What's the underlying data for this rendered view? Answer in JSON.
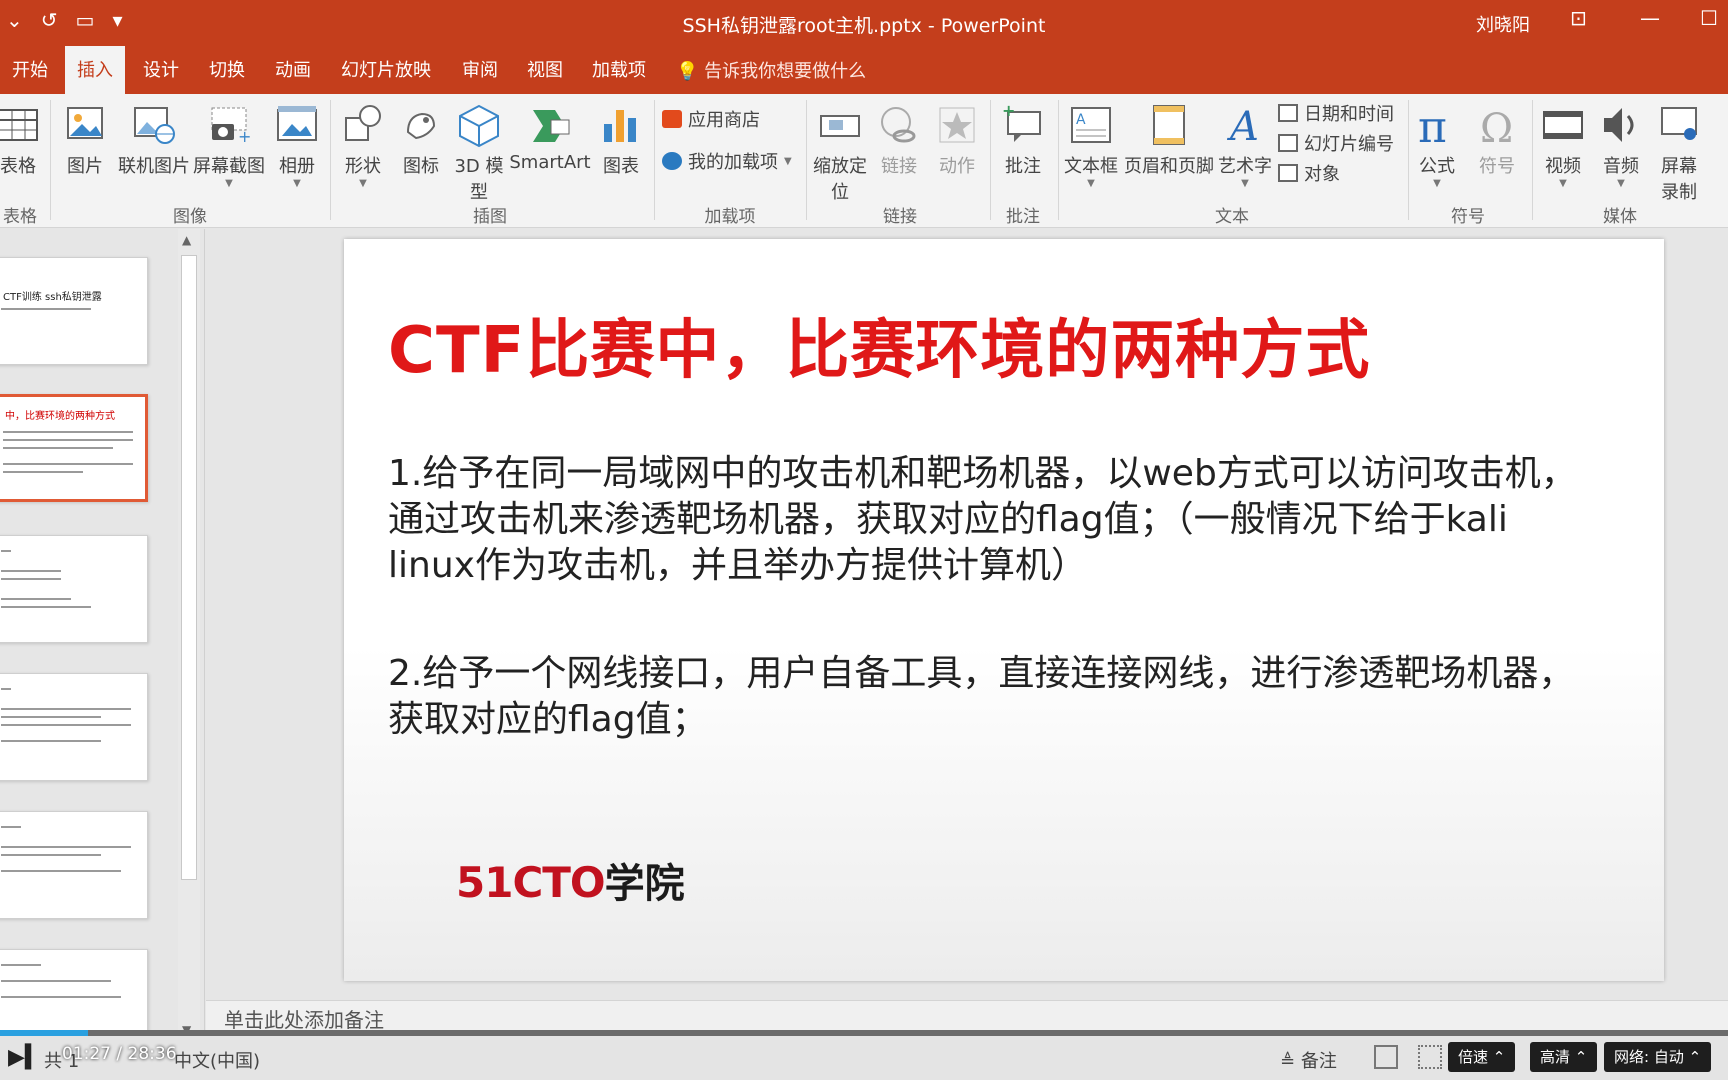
{
  "window": {
    "title": "SSH私钥泄露root主机.pptx  -  PowerPoint",
    "user": "刘晓阳"
  },
  "tabs": [
    "开始",
    "插入",
    "设计",
    "切换",
    "动画",
    "幻灯片放映",
    "审阅",
    "视图",
    "加载项"
  ],
  "active_tab": "插入",
  "tell_me": "告诉我你想要做什么",
  "share_label": "共",
  "ribbon": {
    "groups": {
      "tables": "表格",
      "images": "图像",
      "illustrations": "插图",
      "addins": "加载项",
      "links": "链接",
      "comments": "批注",
      "text": "文本",
      "symbols": "符号",
      "media": "媒体"
    },
    "buttons": {
      "table": "表格",
      "picture": "图片",
      "online_picture": "联机图片",
      "screenshot": "屏幕截图",
      "album": "相册",
      "shapes": "形状",
      "icons": "图标",
      "model3d_1": "3D 模",
      "model3d_2": "型",
      "smartart": "SmartArt",
      "chart": "图表",
      "store": "应用商店",
      "my_addins": "我的加载项",
      "zoom_1": "缩放定",
      "zoom_2": "位",
      "link": "链接",
      "action": "动作",
      "comment": "批注",
      "textbox": "文本框",
      "header_footer": "页眉和页脚",
      "wordart": "艺术字",
      "datetime": "日期和时间",
      "slide_number": "幻灯片编号",
      "object": "对象",
      "equation": "公式",
      "symbol": "符号",
      "video": "视频",
      "audio": "音频",
      "screen_rec_1": "屏幕",
      "screen_rec_2": "录制"
    }
  },
  "thumbnails": [
    {
      "title": "CTF训练 ssh私钥泄露",
      "red": false,
      "selected": false
    },
    {
      "title": "中，比赛环境的两种方式",
      "red": true,
      "selected": true
    },
    {
      "title": "",
      "red": false,
      "selected": false
    },
    {
      "title": "",
      "red": false,
      "selected": false
    },
    {
      "title": "",
      "red": false,
      "selected": false
    },
    {
      "title": "",
      "red": false,
      "selected": false
    }
  ],
  "slide": {
    "title": "CTF比赛中，比赛环境的两种方式",
    "para1": "1.给予在同一局域网中的攻击机和靶场机器，以web方式可以访问攻击机，通过攻击机来渗透靶场机器，获取对应的flag值；（一般情况下给于kali linux作为攻击机，并且举办方提供计算机）",
    "para2": "2.给予一个网线接口，用户自备工具，直接连接网线，进行渗透靶场机器，获取对应的flag值；",
    "logo_num": "51CTO",
    "logo_txt": "学院"
  },
  "notes_placeholder": "单击此处添加备注",
  "status": {
    "slide_count": "共 1",
    "language": "中文(中国)",
    "notes_btn": "备注",
    "time": "01:27 / 28:36",
    "played_fraction": 0.051,
    "speed": "倍速",
    "quality": "高清",
    "network": "网络: 自动"
  },
  "colors": {
    "accent": "#c43e1c",
    "slide_title": "#e01818",
    "logo_red": "#c1121f"
  }
}
